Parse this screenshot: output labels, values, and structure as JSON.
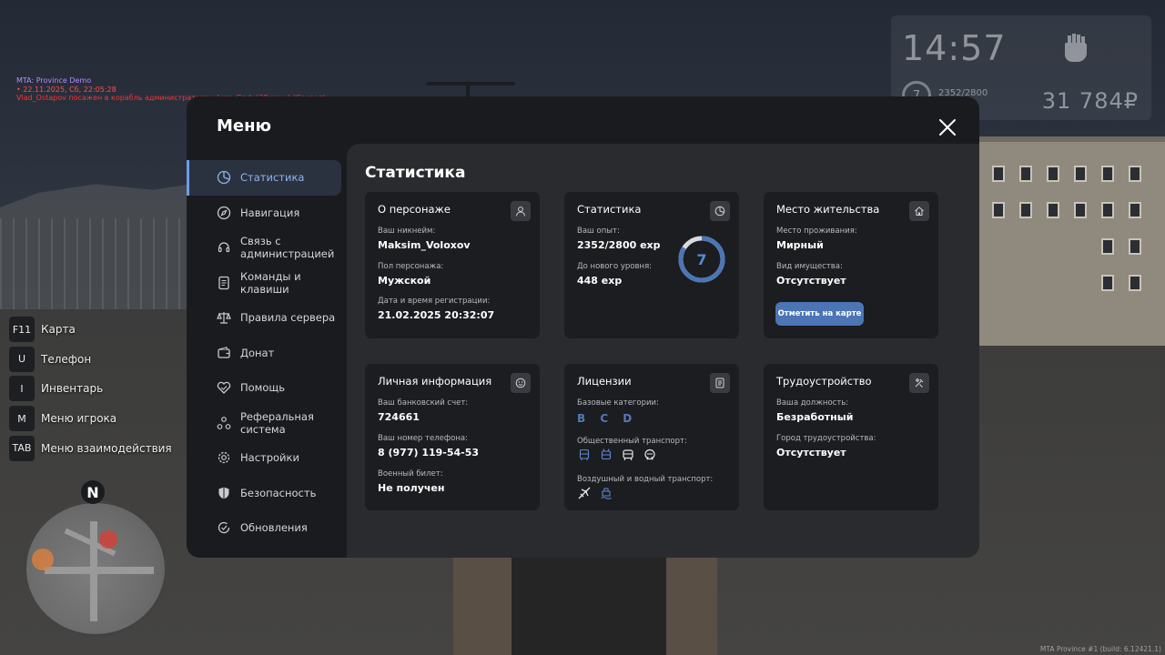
{
  "chat": {
    "line1": "MTA: Province Demo",
    "line2": "• 22.11.2025, Сб, 22:05:28",
    "line3": "Vlad_Ostapov посажен в корабль администратором Ivan_Gryb (30 мин.) (Срезал)"
  },
  "hud": {
    "time": "14:57",
    "level": "7",
    "exp": "2352/2800",
    "money": "31 784₽"
  },
  "hotkeys": [
    {
      "key": "F11",
      "label": "Карта"
    },
    {
      "key": "U",
      "label": "Телефон"
    },
    {
      "key": "I",
      "label": "Инвентарь"
    },
    {
      "key": "M",
      "label": "Меню игрока"
    },
    {
      "key": "TAB",
      "label": "Меню взаимодействия"
    }
  ],
  "minimap": {
    "north": "N"
  },
  "build": "MTA Province #1 (build: 6.12421.1)",
  "menu": {
    "title": "Меню",
    "sidebar": [
      {
        "label": "Статистика",
        "icon": "pie-chart-icon"
      },
      {
        "label": "Навигация",
        "icon": "compass-icon"
      },
      {
        "label": "Связь с администрацией",
        "icon": "headset-icon"
      },
      {
        "label": "Команды и клавиши",
        "icon": "document-icon"
      },
      {
        "label": "Правила сервера",
        "icon": "scales-icon"
      },
      {
        "label": "Донат",
        "icon": "wallet-icon"
      },
      {
        "label": "Помощь",
        "icon": "heart-handshake-icon"
      },
      {
        "label": "Реферальная система",
        "icon": "referral-icon"
      },
      {
        "label": "Настройки",
        "icon": "gear-icon"
      },
      {
        "label": "Безопасность",
        "icon": "shield-icon"
      },
      {
        "label": "Обновления",
        "icon": "refresh-check-icon"
      }
    ],
    "content_title": "Статистика",
    "cards": {
      "character": {
        "title": "О персонаже",
        "nick_label": "Ваш никнейм:",
        "nick": "Maksim_Voloxov",
        "gender_label": "Пол персонажа:",
        "gender": "Мужской",
        "reg_label": "Дата и время регистрации:",
        "reg": "21.02.2025 20:32:07"
      },
      "stats": {
        "title": "Статистика",
        "exp_label": "Ваш опыт:",
        "exp": "2352/2800 exp",
        "next_label": "До нового уровня:",
        "next": "448 exp",
        "level": "7",
        "progress": 0.84
      },
      "residence": {
        "title": "Место жительства",
        "place_label": "Место проживания:",
        "place": "Мирный",
        "property_label": "Вид имущества:",
        "property": "Отсутствует",
        "button": "Отметить на карте"
      },
      "personal": {
        "title": "Личная информация",
        "bank_label": "Ваш банковский счет:",
        "bank": "724661",
        "phone_label": "Ваш номер телефона:",
        "phone": "8 (977) 119-54-53",
        "military_label": "Военный билет:",
        "military": "Не получен"
      },
      "licenses": {
        "title": "Лицензии",
        "basic_label": "Базовые категории:",
        "categories": "B C D",
        "public_label": "Общественный транспорт:",
        "air_label": "Воздушный и водный транспорт:"
      },
      "job": {
        "title": "Трудоустройство",
        "position_label": "Ваша должность:",
        "position": "Безработный",
        "city_label": "Город трудоустройства:",
        "city": "Отсутствует"
      }
    }
  },
  "colors": {
    "accent": "#5b89d2",
    "button": "#4c75b6",
    "panel": "#1a1b1e",
    "content": "#2a2b2e",
    "card": "#1c1d20"
  }
}
